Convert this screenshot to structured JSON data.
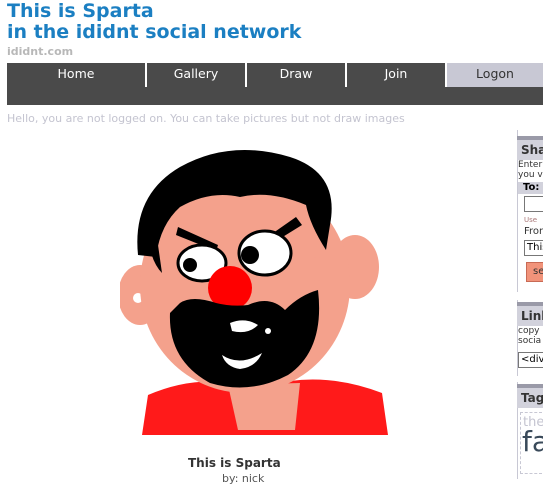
{
  "site": {
    "title_line1": "This is Sparta",
    "title_line2": "in the ididnt social network",
    "domain": "ididnt.com"
  },
  "nav": {
    "items": [
      {
        "label": "Home"
      },
      {
        "label": "Gallery"
      },
      {
        "label": "Draw"
      },
      {
        "label": "Join"
      },
      {
        "label": "Logon"
      }
    ]
  },
  "status": {
    "message": "Hello, you are not logged on. You can take pictures but not draw images"
  },
  "image": {
    "title": "This is Sparta",
    "author": "by: nick"
  },
  "sidebar": {
    "share": {
      "heading": "Sha",
      "intro_line1": "Enter",
      "intro_line2": "you v",
      "to_label": "To:",
      "to_value": "",
      "hint": "Use",
      "from_label": "From",
      "from_value": "This",
      "send_label": "se"
    },
    "link": {
      "heading": "Link",
      "text_line1": "copy",
      "text_line2": "socia",
      "embed_value": "<div"
    },
    "tags": {
      "heading": "Tag",
      "tag_small": "the",
      "tag_large": "fa"
    }
  },
  "colors": {
    "title_blue": "#1b7fc2",
    "nav_bg": "#4a4a4a",
    "nav_active_bg": "#c8c8d4",
    "face_skin": "#f4a18c",
    "hair": "#000000",
    "nose": "#ff0000",
    "shirt": "#ff1a1a"
  }
}
